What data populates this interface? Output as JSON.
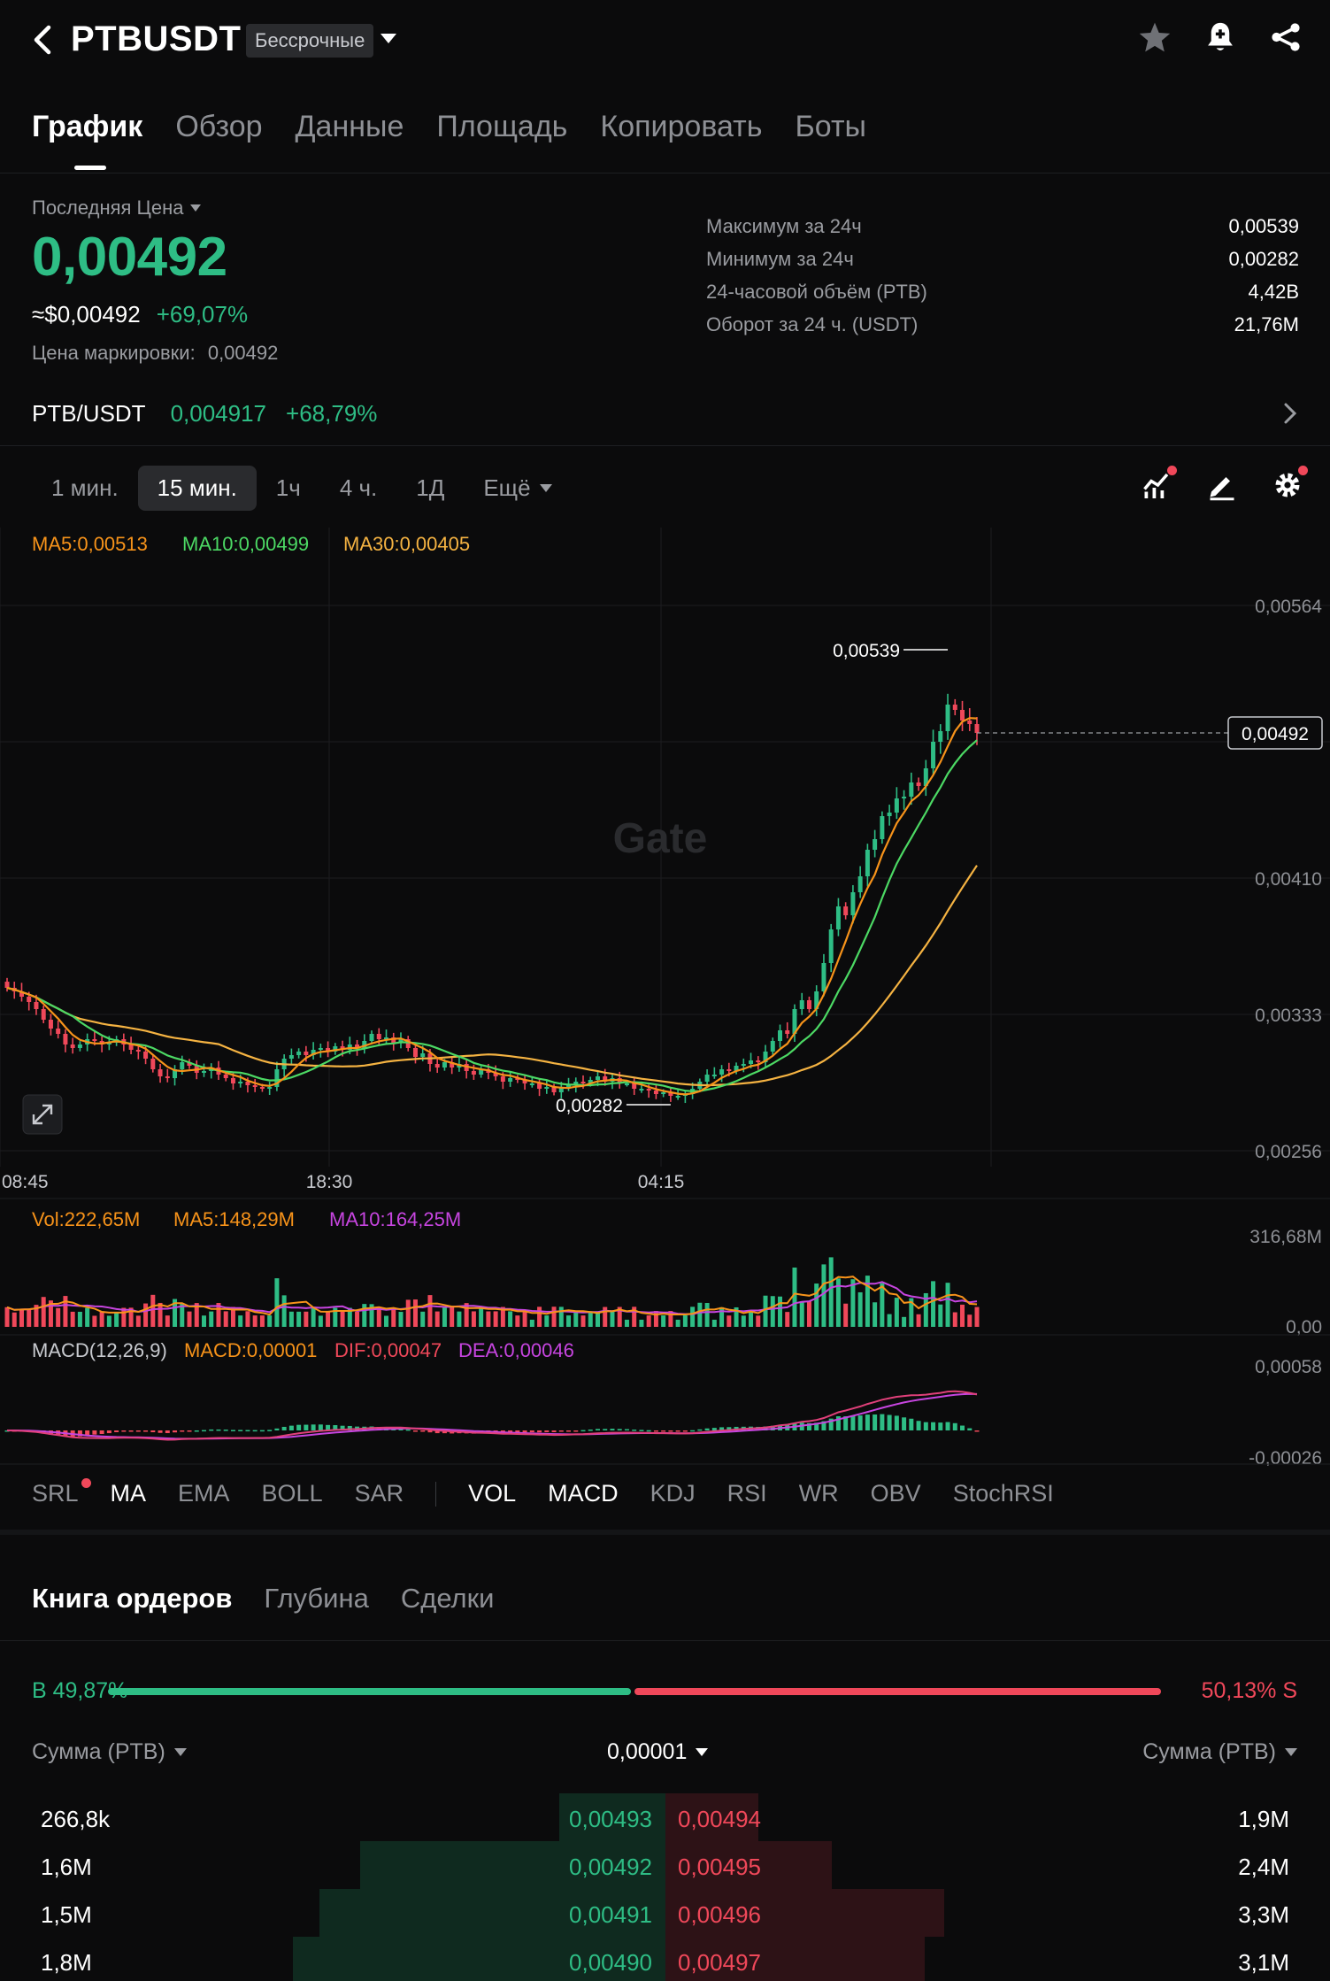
{
  "header": {
    "symbol": "PTBUSDT",
    "contract_type": "Бессрочные",
    "icons": [
      "back-icon",
      "star-icon",
      "bell-plus-icon",
      "share-icon"
    ]
  },
  "tabs": [
    "График",
    "Обзор",
    "Данные",
    "Площадь",
    "Копировать",
    "Боты"
  ],
  "price": {
    "last_label": "Последняя Цена",
    "last": "0,00492",
    "usd": "≈$0,00492",
    "change": "+69,07%",
    "mark_label": "Цена маркировки:",
    "mark": "0,00492"
  },
  "stats": [
    {
      "label": "Максимум за 24ч",
      "value": "0,00539"
    },
    {
      "label": "Минимум за 24ч",
      "value": "0,00282"
    },
    {
      "label": "24-часовой объём (PTB)",
      "value": "4,42B"
    },
    {
      "label": "Оборот за 24 ч. (USDT)",
      "value": "21,76M"
    }
  ],
  "spot_pair": {
    "name": "PTB/USDT",
    "price": "0,004917",
    "change": "+68,79%"
  },
  "timeframes": {
    "items": [
      "1 мин.",
      "15 мин.",
      "1ч",
      "4 ч.",
      "1Д"
    ],
    "active": "15 мин.",
    "more": "Ещё"
  },
  "chart_data": {
    "type": "candlestick",
    "ma_legend": {
      "ma5": "MA5:0,00513",
      "ma10": "MA10:0,00499",
      "ma30": "MA30:0,00405"
    },
    "price_ticks": [
      "0,00564",
      "0,00410",
      "0,00333",
      "0,00256"
    ],
    "price_tick_values": [
      0.00564,
      0.0041,
      0.00333,
      0.00256
    ],
    "ylim": [
      0.00256,
      0.00564
    ],
    "time_ticks": [
      "08:45",
      "18:30",
      "04:15"
    ],
    "high_label": "0,00539",
    "low_label": "0,00282",
    "current_label": "0,00492",
    "current_value": 0.00492,
    "watermark": "Gate",
    "volume": {
      "vol": "Vol:222,65M",
      "ma5": "MA5:148,29M",
      "ma10": "MA10:164,25M",
      "max_tick": "316,68M",
      "min_tick": "0,00"
    },
    "macd": {
      "title": "MACD(12,26,9)",
      "macd": "MACD:0,00001",
      "dif": "DIF:0,00047",
      "dea": "DEA:0,00046",
      "max_tick": "0,00058",
      "min_tick": "-0,00026"
    },
    "candles_close": [
      0.00348,
      0.00346,
      0.00343,
      0.0034,
      0.00336,
      0.0033,
      0.00325,
      0.00322,
      0.00316,
      0.00314,
      0.00316,
      0.00319,
      0.00318,
      0.00316,
      0.00317,
      0.00319,
      0.00316,
      0.00313,
      0.00312,
      0.00308,
      0.00302,
      0.00298,
      0.00297,
      0.00302,
      0.00306,
      0.00304,
      0.003,
      0.00301,
      0.00303,
      0.00299,
      0.00297,
      0.00294,
      0.00295,
      0.00293,
      0.00292,
      0.00291,
      0.00292,
      0.00302,
      0.00308,
      0.0031,
      0.00312,
      0.0031,
      0.00313,
      0.00314,
      0.00312,
      0.00315,
      0.00313,
      0.00316,
      0.00314,
      0.00318,
      0.00322,
      0.00319,
      0.0032,
      0.00317,
      0.00319,
      0.00314,
      0.00309,
      0.00311,
      0.00305,
      0.00303,
      0.00306,
      0.00303,
      0.00305,
      0.00301,
      0.00299,
      0.00302,
      0.003,
      0.00298,
      0.00295,
      0.00297,
      0.00296,
      0.00294,
      0.00294,
      0.00291,
      0.00292,
      0.00289,
      0.00292,
      0.00293,
      0.00295,
      0.00294,
      0.00296,
      0.00298,
      0.00295,
      0.00297,
      0.00294,
      0.00294,
      0.00291,
      0.00291,
      0.0029,
      0.00288,
      0.00289,
      0.00287,
      0.00287,
      0.00288,
      0.00291,
      0.00295,
      0.00299,
      0.00299,
      0.00302,
      0.00301,
      0.00304,
      0.00305,
      0.00307,
      0.00306,
      0.00312,
      0.00318,
      0.00324,
      0.00322,
      0.00336,
      0.00341,
      0.00336,
      0.00346,
      0.00362,
      0.00381,
      0.00394,
      0.00389,
      0.00402,
      0.00411,
      0.00426,
      0.00432,
      0.00445,
      0.00447,
      0.00455,
      0.00456,
      0.00464,
      0.00462,
      0.00472,
      0.00487,
      0.00493,
      0.00508,
      0.00505,
      0.00499,
      0.00497,
      0.00492
    ]
  },
  "indicators": {
    "main": [
      "SRL",
      "MA",
      "EMA",
      "BOLL",
      "SAR"
    ],
    "sub": [
      "VOL",
      "MACD",
      "KDJ",
      "RSI",
      "WR",
      "OBV",
      "StochRSI"
    ]
  },
  "orderbook": {
    "tabs": [
      "Книга ордеров",
      "Глубина",
      "Сделки"
    ],
    "buy_ratio": "B 49,87%",
    "sell_ratio": "50,13% S",
    "buy_pct": 49.87,
    "col_left": "Сумма (PTB)",
    "col_mid": "0,00001",
    "col_right": "Сумма (PTB)",
    "rows": [
      {
        "bid_amt": "266,8k",
        "bid": "0,00493",
        "ask": "0,00494",
        "ask_amt": "1,9M",
        "bid_depth": 0.16,
        "ask_depth": 0.14
      },
      {
        "bid_amt": "1,6M",
        "bid": "0,00492",
        "ask": "0,00495",
        "ask_amt": "2,4M",
        "bid_depth": 0.46,
        "ask_depth": 0.25
      },
      {
        "bid_amt": "1,5M",
        "bid": "0,00491",
        "ask": "0,00496",
        "ask_amt": "3,3M",
        "bid_depth": 0.52,
        "ask_depth": 0.42
      },
      {
        "bid_amt": "1,8M",
        "bid": "0,00490",
        "ask": "0,00497",
        "ask_amt": "3,1M",
        "bid_depth": 0.56,
        "ask_depth": 0.39
      }
    ]
  }
}
